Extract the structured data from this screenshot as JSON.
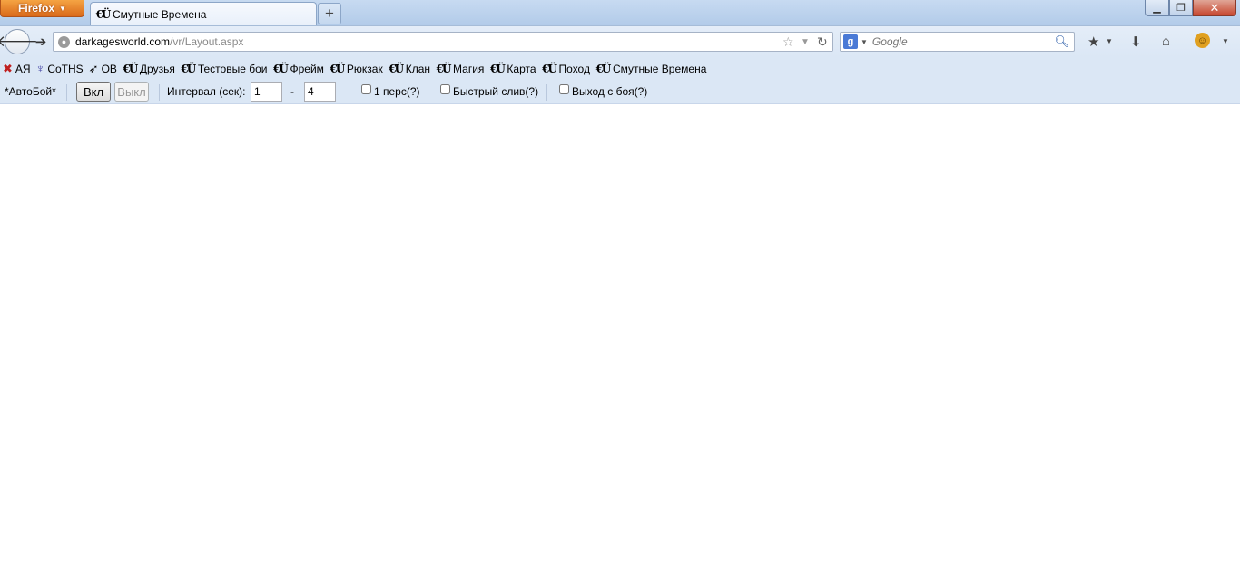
{
  "titlebar": {
    "app_button_label": "Firefox",
    "tab_title": "Смутные Времена",
    "new_tab_label": "+"
  },
  "window_controls": {
    "minimize": "▁",
    "maximize": "❐",
    "close": "✕"
  },
  "navigation": {
    "url_host": "darkagesworld.com",
    "url_path": "/vr/Layout.aspx",
    "search_placeholder": "Google",
    "search_engine_letter": "g"
  },
  "bookmarks": [
    {
      "label": "АЯ",
      "icon": "star-badge-icon"
    },
    {
      "label": "CoTHS",
      "icon": "shield-emblem-icon"
    },
    {
      "label": "ОВ",
      "icon": "bird-icon"
    },
    {
      "label": "Друзья",
      "icon": "site-glyph-icon"
    },
    {
      "label": "Тестовые бои",
      "icon": "site-glyph-icon"
    },
    {
      "label": "Фрейм",
      "icon": "site-glyph-icon"
    },
    {
      "label": "Рюкзак",
      "icon": "site-glyph-icon"
    },
    {
      "label": "Клан",
      "icon": "site-glyph-icon"
    },
    {
      "label": "Магия",
      "icon": "site-glyph-icon"
    },
    {
      "label": "Карта",
      "icon": "site-glyph-icon"
    },
    {
      "label": "Поход",
      "icon": "site-glyph-icon"
    },
    {
      "label": "Смутные Времена",
      "icon": "site-glyph-icon"
    }
  ],
  "autobattle": {
    "title": "*АвтоБой*",
    "on_label": "Вкл",
    "off_label": "Выкл",
    "interval_label": "Интервал (сек):",
    "interval_from": "1",
    "dash": "-",
    "interval_to": "4",
    "single_char_label": "1 перс(?)",
    "quick_drain_label": "Быстрый слив(?)",
    "exit_battle_label": "Выход с боя(?)"
  },
  "colors": {
    "chrome": "#dbe7f5",
    "firefox_button": "#e0781f",
    "close_button": "#c7462e"
  }
}
